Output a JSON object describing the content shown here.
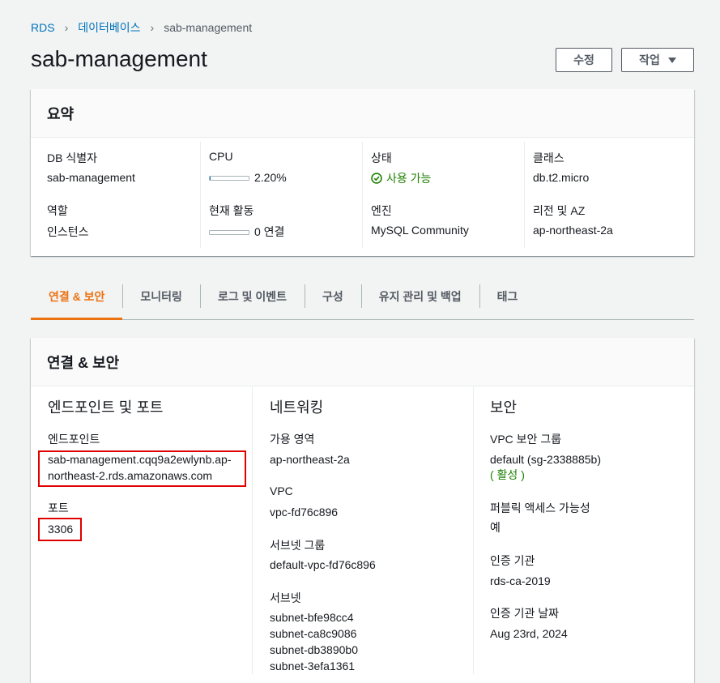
{
  "breadcrumb": {
    "root": "RDS",
    "databases": "데이터베이스",
    "current": "sab-management"
  },
  "page_title": "sab-management",
  "buttons": {
    "edit": "수정",
    "actions": "작업"
  },
  "summary": {
    "title": "요약",
    "db_identifier": {
      "label": "DB 식별자",
      "value": "sab-management"
    },
    "role": {
      "label": "역할",
      "value": "인스턴스"
    },
    "cpu": {
      "label": "CPU",
      "value": "2.20%",
      "percent": 2.2
    },
    "activity": {
      "label": "현재 활동",
      "value": "0 연결",
      "percent": 0
    },
    "status": {
      "label": "상태",
      "value": "사용 가능",
      "color": "#1d8102"
    },
    "engine": {
      "label": "엔진",
      "value": "MySQL Community"
    },
    "class": {
      "label": "클래스",
      "value": "db.t2.micro"
    },
    "region": {
      "label": "리전 및 AZ",
      "value": "ap-northeast-2a"
    }
  },
  "tabs": [
    {
      "label": "연결 & 보안",
      "active": true
    },
    {
      "label": "모니터링"
    },
    {
      "label": "로그 및 이벤트"
    },
    {
      "label": "구성"
    },
    {
      "label": "유지 관리 및 백업"
    },
    {
      "label": "태그"
    }
  ],
  "connectivity": {
    "title": "연결 & 보안",
    "endpoint_port": {
      "title": "엔드포인트 및 포트",
      "endpoint_label": "엔드포인트",
      "endpoint_line1": "sab-management.cqq9a2ewlynb.ap-",
      "endpoint_line2": "northeast-2.rds.amazonaws.com",
      "port_label": "포트",
      "port_value": "3306"
    },
    "networking": {
      "title": "네트워킹",
      "az_label": "가용 영역",
      "az_value": "ap-northeast-2a",
      "vpc_label": "VPC",
      "vpc_value": "vpc-fd76c896",
      "subnet_group_label": "서브넷 그룹",
      "subnet_group_value": "default-vpc-fd76c896",
      "subnets_label": "서브넷",
      "subnets": [
        "subnet-bfe98cc4",
        "subnet-ca8c9086",
        "subnet-db3890b0",
        "subnet-3efa1361"
      ]
    },
    "security": {
      "title": "보안",
      "sg_label": "VPC 보안 그룹",
      "sg_value": "default (sg-2338885b)",
      "sg_status": "( 활성 )",
      "public_label": "퍼블릭 액세스 가능성",
      "public_value": "예",
      "ca_label": "인증 기관",
      "ca_value": "rds-ca-2019",
      "ca_date_label": "인증 기관 날짜",
      "ca_date_value": "Aug 23rd, 2024"
    }
  },
  "colors": {
    "link": "#0073bb",
    "active_tab": "#ec7211",
    "highlight": "#e00000"
  }
}
